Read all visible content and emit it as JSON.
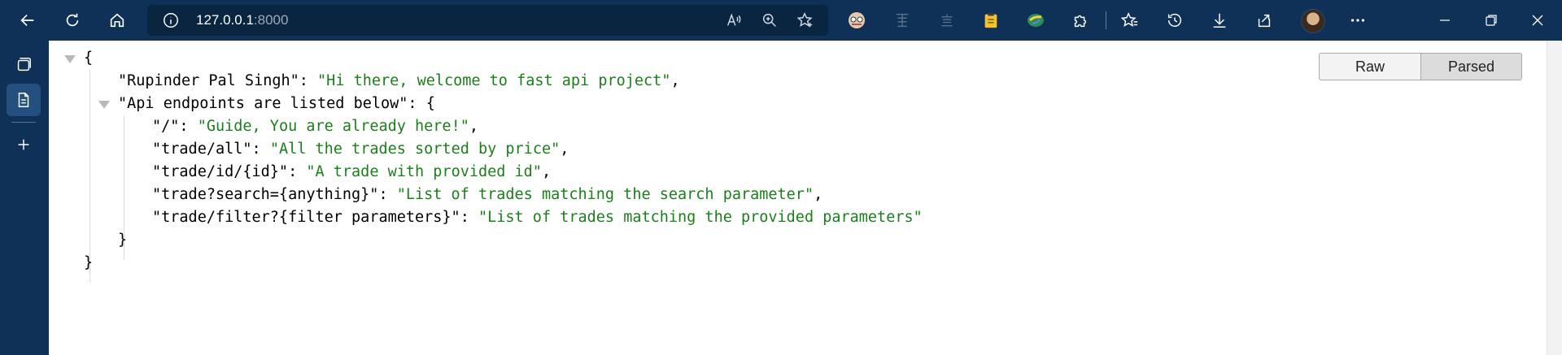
{
  "browser": {
    "address": {
      "host": "127.0.0.1",
      "port": ":8000"
    }
  },
  "viewer": {
    "raw_label": "Raw",
    "parsed_label": "Parsed"
  },
  "json_view": {
    "open_brace": "{",
    "close_brace": "}",
    "inner_close": "}",
    "key1": "\"Rupinder Pal Singh\"",
    "val1": "\"Hi there, welcome to fast api project\"",
    "key2": "\"Api endpoints are listed below\"",
    "entries": [
      {
        "key": "\"/\"",
        "value": "\"Guide, You are already here!\""
      },
      {
        "key": "\"trade/all\"",
        "value": "\"All the trades sorted by price\""
      },
      {
        "key": "\"trade/id/{id}\"",
        "value": "\"A trade with provided id\""
      },
      {
        "key": "\"trade?search={anything}\"",
        "value": "\"List of trades matching the search parameter\""
      },
      {
        "key": "\"trade/filter?{filter parameters}\"",
        "value": "\"List of trades matching the provided parameters\""
      }
    ]
  }
}
